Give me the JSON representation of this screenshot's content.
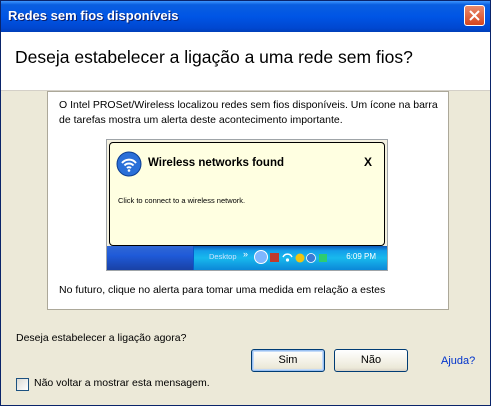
{
  "window": {
    "title": "Redes sem fios disponíveis"
  },
  "header": {
    "title": "Deseja estabelecer a ligação a uma rede sem fios?"
  },
  "info": {
    "text": "O Intel PROSet/Wireless localizou redes sem fios disponíveis. Um ícone na barra de tarefas mostra um alerta deste acontecimento importante.",
    "footer": "No futuro, clique no alerta para tomar uma medida em relação a estes"
  },
  "balloon": {
    "title": "Wireless networks found",
    "close": "X",
    "message": "Click to connect to a wireless network."
  },
  "taskbar": {
    "desktop_label": "Desktop",
    "chevron": "»",
    "clock": "6:09 PM"
  },
  "dialog": {
    "question": "Deseja estabelecer a ligação agora?",
    "yes_label": "Sim",
    "no_label": "Não",
    "help_label": "Ajuda?",
    "checkbox_label": "Não voltar a mostrar esta mensagem.",
    "checkbox_checked": false
  },
  "colors": {
    "titlebar": "#0055e5",
    "link": "#0033cc",
    "balloon_bg": "#ffffe1",
    "dialog_bg": "#ece9d8"
  }
}
